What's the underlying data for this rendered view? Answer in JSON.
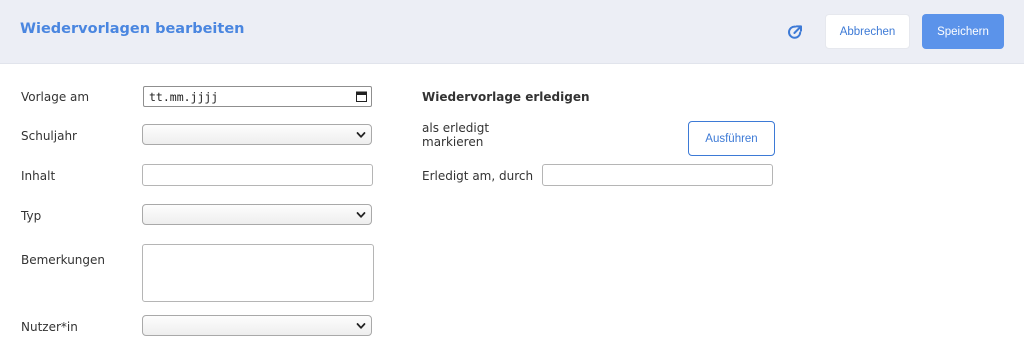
{
  "header": {
    "title": "Wiedervorlagen bearbeiten",
    "open_icon": "external-link-icon",
    "cancel_label": "Abbrechen",
    "save_label": "Speichern"
  },
  "form": {
    "vorlage_am": {
      "label": "Vorlage am",
      "placeholder": "tt.mm.jjjj",
      "value": ""
    },
    "schuljahr": {
      "label": "Schuljahr",
      "value": ""
    },
    "inhalt": {
      "label": "Inhalt",
      "value": ""
    },
    "typ": {
      "label": "Typ",
      "value": ""
    },
    "bemerkungen": {
      "label": "Bemerkungen",
      "value": ""
    },
    "nutzer": {
      "label": "Nutzer*in",
      "value": ""
    }
  },
  "erledigen": {
    "title": "Wiedervorlage erledigen",
    "mark_label_line1": "als erledigt",
    "mark_label_line2": "markieren",
    "execute_label": "Ausführen",
    "erledigt_label": "Erledigt am, durch",
    "erledigt_value": ""
  },
  "colors": {
    "accent": "#4a86e0",
    "primary_button": "#5b93ea",
    "header_bg": "#eceef5"
  }
}
